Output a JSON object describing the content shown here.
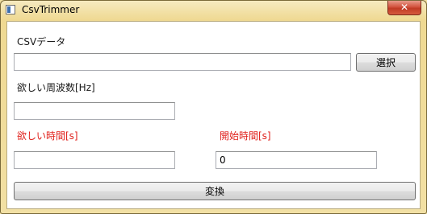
{
  "window": {
    "title": "CsvTrimmer",
    "close_label": "✕"
  },
  "form": {
    "csv_label": "CSVデータ",
    "csv_path": "",
    "select_button": "選択",
    "frequency_label": "欲しい周波数[Hz]",
    "frequency_value": "",
    "duration_label": "欲しい時間[s]",
    "duration_value": "",
    "start_label": "開始時間[s]",
    "start_value": "0",
    "convert_button": "変換"
  },
  "colors": {
    "highlight_label": "#e0201b",
    "title_bar": "#efd992",
    "close_button": "#c03b25"
  }
}
